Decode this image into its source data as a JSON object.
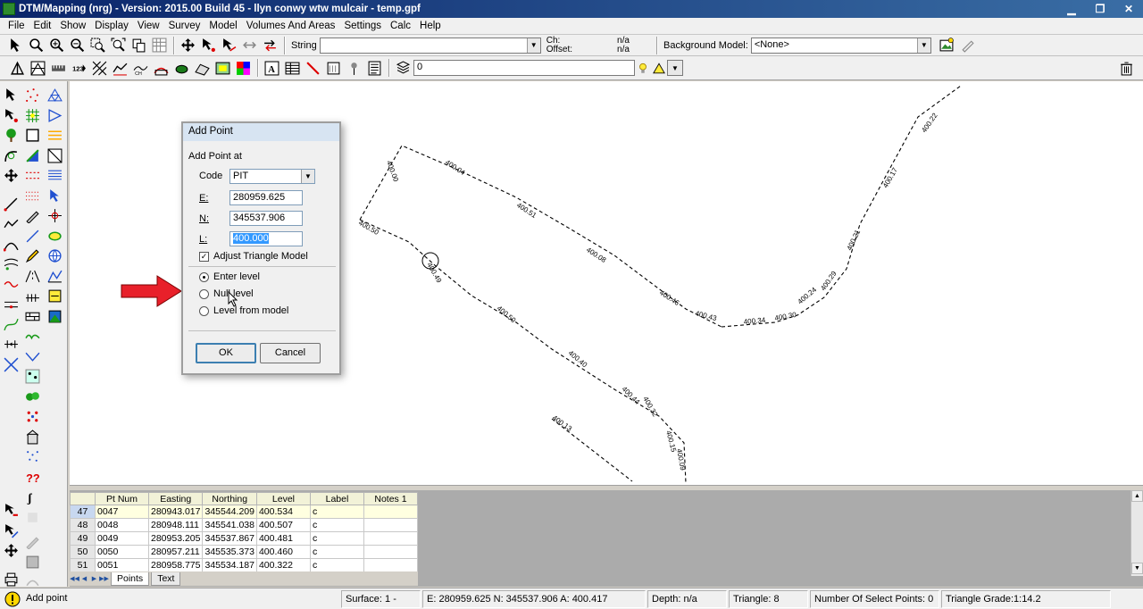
{
  "window": {
    "title": "DTM/Mapping (nrg) - Version: 2015.00 Build 45 - llyn conwy wtw mulcair - temp.gpf",
    "minimize": "▁",
    "restore": "❐",
    "close": "✕"
  },
  "menu": [
    "File",
    "Edit",
    "Show",
    "Display",
    "View",
    "Survey",
    "Model",
    "Volumes And Areas",
    "Settings",
    "Calc",
    "Help"
  ],
  "toolbar1": {
    "string_label": "String",
    "string_value": "",
    "ch_label": "Ch:",
    "offset_label": "Offset:",
    "ch_value": "n/a",
    "offset_value": "n/a",
    "background_label": "Background Model:",
    "background_value": "<None>"
  },
  "toolbar2": {
    "layer_value": "0"
  },
  "dialog": {
    "title": "Add Point",
    "section": "Add Point at",
    "code_label": "Code",
    "code_value": "PIT",
    "e_label": "E:",
    "e_value": "280959.625",
    "n_label": "N:",
    "n_value": "345537.906",
    "l_label": "L:",
    "l_value": "400.000",
    "adjust_label": "Adjust Triangle Model",
    "adjust_checked": true,
    "radio_enter": "Enter level",
    "radio_null": "Null level",
    "radio_model": "Level from model",
    "ok": "OK",
    "cancel": "Cancel"
  },
  "canvas_labels": {
    "a": "400.00",
    "b": "400.04",
    "c": "400.51",
    "d": "400.08",
    "e": "400.46",
    "f": "400.43",
    "g": "400.34",
    "h": "400.30",
    "i": "400.24",
    "j": "400.29",
    "k": "400.21",
    "l": "400.17",
    "m": "400.22",
    "n": "400.50",
    "o": "400.49",
    "p": "400.50",
    "q": "400.40",
    "r": "400.44",
    "s": "400.32",
    "t": "400.15",
    "u": "400.09",
    "v": "400.13"
  },
  "grid": {
    "headers": [
      "",
      "Pt Num",
      "Easting",
      "Northing",
      "Level",
      "Label",
      "Notes 1"
    ],
    "rows": [
      [
        "47",
        "0047",
        "280943.017",
        "345544.209",
        "400.534",
        "c",
        ""
      ],
      [
        "48",
        "0048",
        "280948.111",
        "345541.038",
        "400.507",
        "c",
        ""
      ],
      [
        "49",
        "0049",
        "280953.205",
        "345537.867",
        "400.481",
        "c",
        ""
      ],
      [
        "50",
        "0050",
        "280957.211",
        "345535.373",
        "400.460",
        "c",
        ""
      ],
      [
        "51",
        "0051",
        "280958.775",
        "345534.187",
        "400.322",
        "c",
        ""
      ]
    ],
    "tabs": [
      "Points",
      "Text"
    ]
  },
  "status": {
    "message": "Add point",
    "surface": "Surface: 1 -",
    "coords": "E: 280959.625  N: 345537.906  A: 400.417",
    "depth": "Depth: n/a",
    "triangle": "Triangle: 8",
    "select_points": "Number Of Select Points: 0",
    "grade": "Triangle Grade:1:14.2"
  },
  "colors": {
    "titlebar": "#0a246a",
    "arrow": "#e8202a",
    "selection": "#3399ff"
  }
}
